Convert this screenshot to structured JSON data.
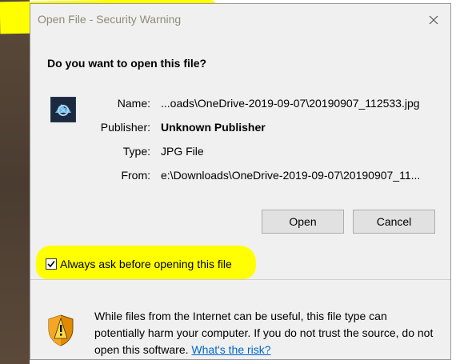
{
  "window": {
    "title": "Open File - Security Warning",
    "close_icon": "close-icon"
  },
  "question": "Do you want to open this file?",
  "file": {
    "icon": "photoshop-file-icon",
    "name_label": "Name:",
    "name_value": "...oads\\OneDrive-2019-09-07\\20190907_112533.jpg",
    "publisher_label": "Publisher:",
    "publisher_value": "Unknown Publisher",
    "type_label": "Type:",
    "type_value": "JPG File",
    "from_label": "From:",
    "from_value": "e:\\Downloads\\OneDrive-2019-09-07\\20190907_11..."
  },
  "buttons": {
    "open": "Open",
    "cancel": "Cancel"
  },
  "checkbox": {
    "label": "Always ask before opening this file",
    "checked": true
  },
  "warning": {
    "icon": "shield-warning-icon",
    "text": "While files from the Internet can be useful, this file type can potentially harm your computer. If you do not trust the source, do not open this software.",
    "link": "What's the risk?"
  },
  "colors": {
    "highlight": "#ffff00",
    "link": "#0066cc",
    "dialog_bg": "#f0f0f0"
  }
}
